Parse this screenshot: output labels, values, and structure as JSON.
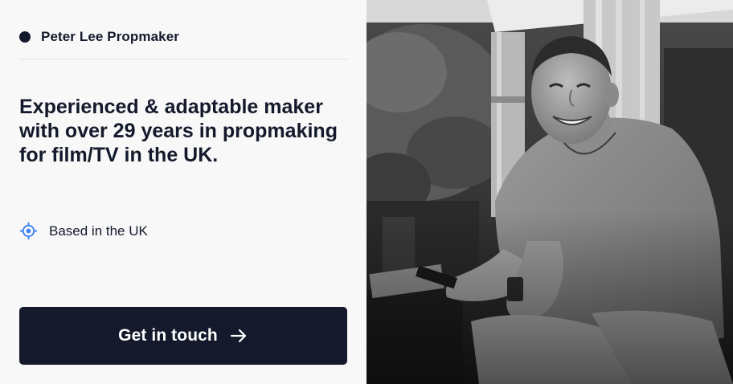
{
  "brand": {
    "name": "Peter Lee Propmaker"
  },
  "hero": {
    "headline": "Experienced & adaptable maker with over 29 years in propmaking for film/TV in the UK."
  },
  "location": {
    "icon": "target-location-icon",
    "text": "Based in the UK"
  },
  "cta": {
    "label": "Get in touch",
    "icon": "arrow-right-icon"
  },
  "colors": {
    "primary": "#141a2b",
    "background": "#f8f8f8",
    "accent_icon": "#3b82f6",
    "divider": "#e2e2e2"
  }
}
